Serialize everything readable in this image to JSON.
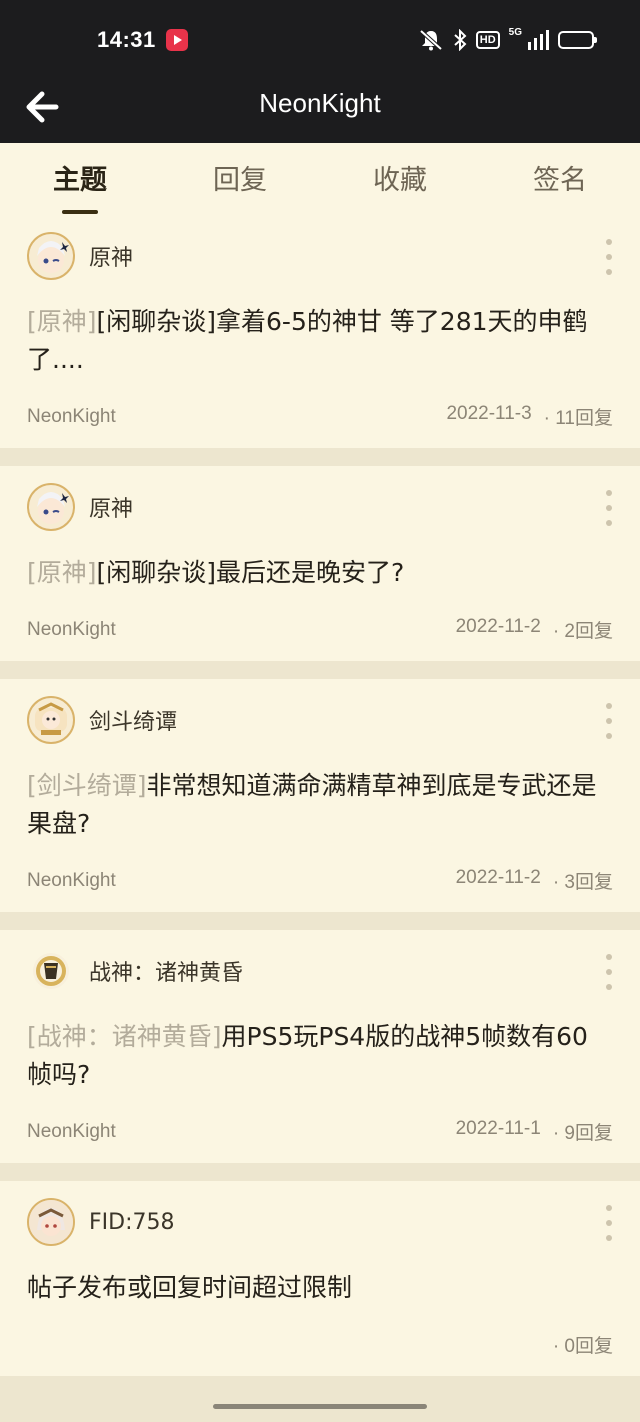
{
  "status_bar": {
    "time": "14:31",
    "network": "5G",
    "hd_label": "HD"
  },
  "app_bar": {
    "title": "NeonKight"
  },
  "tabs": [
    {
      "label": "主题",
      "active": true
    },
    {
      "label": "回复",
      "active": false
    },
    {
      "label": "收藏",
      "active": false
    },
    {
      "label": "签名",
      "active": false
    }
  ],
  "posts": [
    {
      "forum": "原神",
      "tag": "[原神]",
      "title": "[闲聊杂谈]拿着6-5的神甘 等了281天的申鹤了....",
      "author": "NeonKight",
      "date": "2022-11-3",
      "replies": "· 11回复"
    },
    {
      "forum": "原神",
      "tag": "[原神]",
      "title": "[闲聊杂谈]最后还是晚安了?",
      "author": "NeonKight",
      "date": "2022-11-2",
      "replies": "· 2回复"
    },
    {
      "forum": "剑斗绮谭",
      "tag": "[剑斗绮谭]",
      "title": "非常想知道满命满精草神到底是专武还是果盘?",
      "author": "NeonKight",
      "date": "2022-11-2",
      "replies": "· 3回复"
    },
    {
      "forum": "战神：诸神黄昏",
      "tag": "[战神：诸神黄昏]",
      "title": "用PS5玩PS4版的战神5帧数有60帧吗?",
      "author": "NeonKight",
      "date": "2022-11-1",
      "replies": "· 9回复"
    },
    {
      "forum": "FID:758",
      "tag": "",
      "title": "帖子发布或回复时间超过限制",
      "author": "",
      "date": "",
      "replies": "· 0回复"
    }
  ]
}
